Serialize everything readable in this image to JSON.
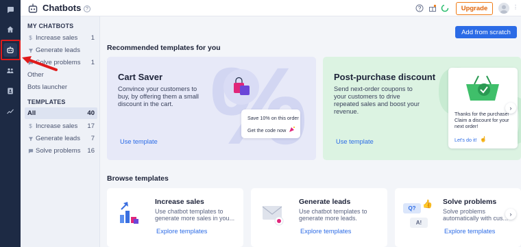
{
  "topbar": {
    "title": "Chatbots",
    "help": "?",
    "upgrade_label": "Upgrade"
  },
  "sidebar": {
    "my_chatbots_heading": "MY CHATBOTS",
    "my_items": [
      {
        "label": "Increase sales",
        "count": "1",
        "icon": "dollar-icon"
      },
      {
        "label": "Generate leads",
        "count": "",
        "icon": "funnel-icon"
      },
      {
        "label": "Solve problems",
        "count": "1",
        "icon": "chat-icon"
      }
    ],
    "other_label": "Other",
    "launcher_label": "Bots launcher",
    "templates_heading": "TEMPLATES",
    "template_items": [
      {
        "label": "All",
        "count": "40",
        "selected": true
      },
      {
        "label": "Increase sales",
        "count": "17",
        "icon": "dollar-icon"
      },
      {
        "label": "Generate leads",
        "count": "7",
        "icon": "funnel-icon"
      },
      {
        "label": "Solve problems",
        "count": "16",
        "icon": "chat-icon"
      }
    ]
  },
  "main": {
    "add_button": "Add from scratch",
    "recommended_heading": "Recommended templates for you",
    "cards": [
      {
        "title": "Cart Saver",
        "description": [
          "Convince your customers to",
          "buy, by offering them a small",
          "discount in the cart."
        ],
        "link": "Use template",
        "bubble_lines": [
          "Save 10% on this order",
          "Get the code now"
        ]
      },
      {
        "title": "Post-purchase discount",
        "description": [
          "Send next-order coupons to",
          "your customers to drive",
          "repeated sales and boost your",
          "revenue."
        ],
        "link": "Use template",
        "bubble_lines": [
          "Thanks for the purchase!",
          "Claim a discount for your",
          "next order!"
        ],
        "bubble_link": "Let's do it!"
      }
    ],
    "browse_heading": "Browse templates",
    "browse": [
      {
        "title": "Increase sales",
        "description": [
          "Use chatbot templates to",
          "generate more sales in you..."
        ],
        "link": "Explore templates"
      },
      {
        "title": "Generate leads",
        "description": [
          "Use chatbot templates to",
          "generate more leads."
        ],
        "link": "Explore templates"
      },
      {
        "title": "Solve problems",
        "description": [
          "Solve problems",
          "automatically with cus..."
        ],
        "link": "Explore templates",
        "art_labels": [
          "Q?",
          "A!"
        ]
      }
    ]
  },
  "colors": {
    "rail": "#1d2a44",
    "accent": "#2b6be6",
    "upgrade": "#f07a12",
    "highlight": "#e01b1b"
  }
}
